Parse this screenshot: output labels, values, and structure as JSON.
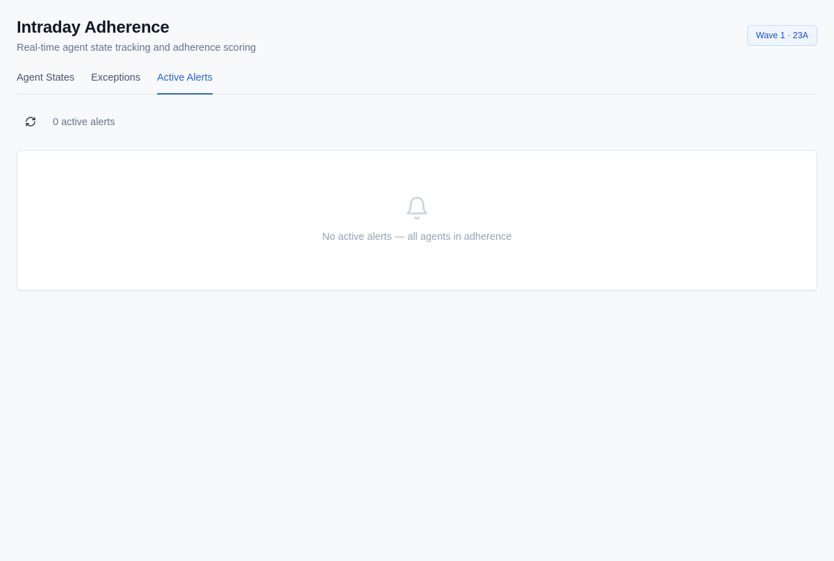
{
  "header": {
    "title": "Intraday Adherence",
    "subtitle": "Real-time agent state tracking and adherence scoring",
    "badge": "Wave 1 · 23A"
  },
  "tabs": [
    {
      "label": "Agent States",
      "active": false
    },
    {
      "label": "Exceptions",
      "active": false
    },
    {
      "label": "Active Alerts",
      "active": true
    }
  ],
  "toolbar": {
    "refresh_icon": "refresh-icon",
    "count_text": "0 active alerts"
  },
  "alerts_panel": {
    "icon": "bell-icon",
    "empty_message": "No active alerts — all agents in adherence"
  },
  "colors": {
    "accent": "#2563eb",
    "background": "#f8f9fb",
    "muted_text": "#64748b",
    "empty_icon": "#cbd5e1"
  }
}
